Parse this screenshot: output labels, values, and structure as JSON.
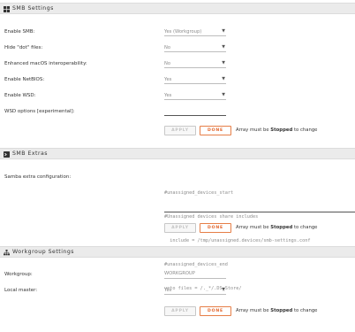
{
  "smb": {
    "title": "SMB Settings",
    "rows": [
      {
        "label": "Enable SMB:",
        "value": "Yes (Workgroup)"
      },
      {
        "label": "Hide \"dot\" files:",
        "value": "No"
      },
      {
        "label": "Enhanced macOS interoperability:",
        "value": "No"
      },
      {
        "label": "Enable NetBIOS:",
        "value": "Yes"
      },
      {
        "label": "Enable WSD:",
        "value": "Yes"
      }
    ],
    "wsd_options_label": "WSD options [experimental]:",
    "wsd_options_value": "",
    "apply_label": "APPLY",
    "done_label": "DONE",
    "note_prefix": "Array must be ",
    "note_bold": "Stopped",
    "note_suffix": " to change"
  },
  "extras": {
    "title": "SMB Extras",
    "label": "Samba extra configuration:",
    "config_lines": [
      "#unassigned_devices_start",
      "#Unassigned devices share includes",
      "  include = /tmp/unassigned.devices/smb-settings.conf",
      "#unassigned_devices_end",
      "veto files = /._*/.DS_Store/"
    ],
    "apply_label": "APPLY",
    "done_label": "DONE",
    "note_prefix": "Array must be ",
    "note_bold": "Stopped",
    "note_suffix": " to change"
  },
  "workgroup": {
    "title": "Workgroup Settings",
    "workgroup_label": "Workgroup:",
    "workgroup_value": "WORKGROUP",
    "local_master_label": "Local master:",
    "local_master_value": "Yes",
    "apply_label": "APPLY",
    "done_label": "DONE",
    "note_prefix": "Array must be ",
    "note_bold": "Stopped",
    "note_suffix": " to change"
  },
  "icons": {
    "smb": "windows-icon",
    "extras": "terminal-icon",
    "workgroup": "sitemap-icon",
    "caret": "chevron-down-icon"
  },
  "colors": {
    "header_bg": "#ebebeb",
    "done_accent": "#e2652b",
    "muted_text": "#8c8c8c"
  }
}
